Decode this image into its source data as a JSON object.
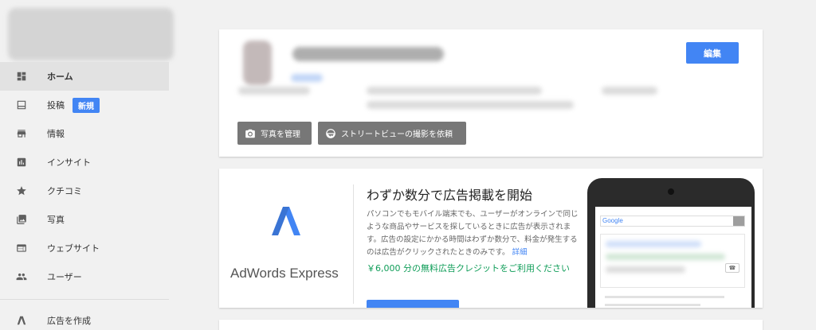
{
  "sidebar": {
    "items": [
      {
        "label": "ホーム",
        "icon": "dashboard-icon",
        "active": true
      },
      {
        "label": "投稿",
        "icon": "post-icon",
        "badge": "新規"
      },
      {
        "label": "情報",
        "icon": "store-icon"
      },
      {
        "label": "インサイト",
        "icon": "insights-icon"
      },
      {
        "label": "クチコミ",
        "icon": "star-icon"
      },
      {
        "label": "写真",
        "icon": "photo-icon"
      },
      {
        "label": "ウェブサイト",
        "icon": "website-icon"
      },
      {
        "label": "ユーザー",
        "icon": "people-icon"
      }
    ],
    "extra": {
      "label": "広告を作成",
      "icon": "adwords-icon"
    }
  },
  "business": {
    "edit_label": "編集",
    "manage_photos_label": "写真を管理",
    "street_view_label": "ストリートビューの撮影を依頼"
  },
  "promo": {
    "product_name": "AdWords Express",
    "title": "わずか数分で広告掲載を開始",
    "body": "パソコンでもモバイル端末でも、ユーザーがオンラインで同じような商品やサービスを探しているときに広告が表示されます。広告の設定にかかる時間はわずか数分で、料金が発生するのは広告がクリックされたときのみです。",
    "detail_link": "詳細",
    "credit_text": "￥6,000 分の無料広告クレジットをご利用ください"
  },
  "phone_mock": {
    "search_logo": "Google"
  },
  "colors": {
    "accent": "#4285f4",
    "credit": "#0f9d58",
    "button_gray": "#777777"
  }
}
